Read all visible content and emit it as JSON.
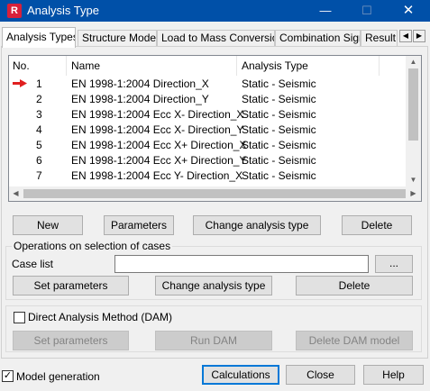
{
  "window": {
    "logo_letter": "R",
    "title": "Analysis Type",
    "min_glyph": "—",
    "max_glyph": "☐",
    "close_glyph": "✕"
  },
  "tabs": [
    {
      "label": "Analysis Types",
      "active": true
    },
    {
      "label": "Structure Model",
      "active": false
    },
    {
      "label": "Load to Mass Conversion",
      "active": false
    },
    {
      "label": "Combination Sign",
      "active": false
    },
    {
      "label": "Result I",
      "active": false
    }
  ],
  "tab_scroll": {
    "left": "◀",
    "right": "▶"
  },
  "cases_table": {
    "columns": [
      "No.",
      "Name",
      "Analysis Type"
    ],
    "current_row_marker": "red-arrow-icon",
    "rows": [
      {
        "no": "1",
        "name": "EN 1998-1:2004 Direction_X",
        "type": "Static - Seismic"
      },
      {
        "no": "2",
        "name": "EN 1998-1:2004 Direction_Y",
        "type": "Static - Seismic"
      },
      {
        "no": "3",
        "name": "EN 1998-1:2004 Ecc X- Direction_X",
        "type": "Static - Seismic"
      },
      {
        "no": "4",
        "name": "EN 1998-1:2004 Ecc X- Direction_Y",
        "type": "Static - Seismic"
      },
      {
        "no": "5",
        "name": "EN 1998-1:2004 Ecc X+ Direction_X",
        "type": "Static - Seismic"
      },
      {
        "no": "6",
        "name": "EN 1998-1:2004 Ecc X+ Direction_Y",
        "type": "Static - Seismic"
      },
      {
        "no": "7",
        "name": "EN 1998-1:2004 Ecc Y- Direction_X",
        "type": "Static - Seismic"
      }
    ]
  },
  "scroll_glyphs": {
    "up": "▲",
    "down": "▼",
    "left": "◀",
    "right": "▶"
  },
  "case_buttons": {
    "new": "New",
    "parameters": "Parameters",
    "change_type": "Change analysis type",
    "delete": "Delete"
  },
  "operations": {
    "title": "Operations on selection of cases",
    "case_list_label": "Case list",
    "case_list_value": "",
    "browse": "...",
    "set_parameters": "Set parameters",
    "change_type": "Change analysis type",
    "delete": "Delete"
  },
  "dam": {
    "checkbox_label": "Direct Analysis Method (DAM)",
    "checked": false,
    "set_parameters": "Set parameters",
    "run": "Run DAM",
    "delete_model": "Delete DAM model"
  },
  "footer": {
    "model_generation_label": "Model generation",
    "model_generation_checked": true,
    "check_glyph": "✓",
    "calculations": "Calculations",
    "close": "Close",
    "help": "Help"
  },
  "colors": {
    "titlebar": "#0050a8",
    "accent": "#0078d7",
    "marker": "#e02020"
  }
}
